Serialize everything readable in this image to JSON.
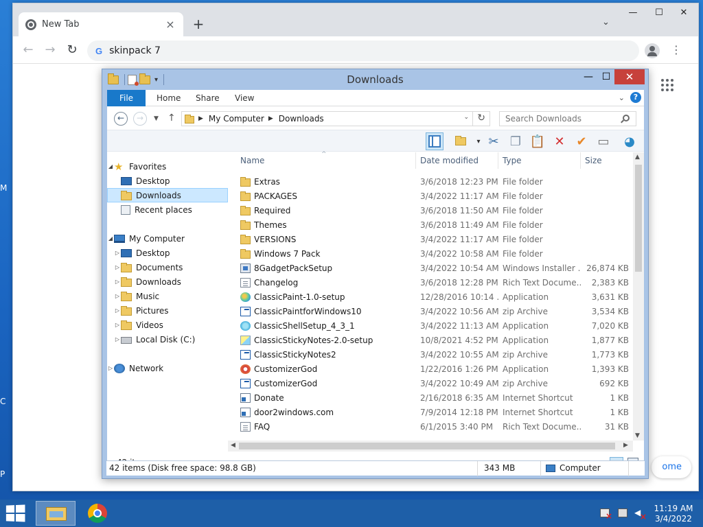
{
  "chrome": {
    "tab_title": "New Tab",
    "tab_close": "×",
    "new_tab": "+",
    "tab_search": "⌄",
    "omnibox_text": "skinpack 7",
    "g_letter": "G",
    "win_min": "—",
    "win_max": "☐",
    "win_close": "✕",
    "back": "←",
    "forward": "→",
    "reload": "↻",
    "menu": "⋮",
    "home_partial": "ome"
  },
  "explorer": {
    "title": "Downloads",
    "ribbon_tabs": [
      "File",
      "Home",
      "Share",
      "View"
    ],
    "help": "?",
    "ribbon_chevron": "⌄",
    "address": {
      "crumbs": [
        "My Computer",
        "Downloads"
      ]
    },
    "search_placeholder": "Search Downloads",
    "nav": {
      "favorites": "Favorites",
      "fav_items": [
        "Desktop",
        "Downloads",
        "Recent places"
      ],
      "computer": "My Computer",
      "computer_items": [
        "Desktop",
        "Documents",
        "Downloads",
        "Music",
        "Pictures",
        "Videos",
        "Local Disk (C:)"
      ],
      "network": "Network"
    },
    "columns": {
      "name": "Name",
      "date": "Date modified",
      "type": "Type",
      "size": "Size"
    },
    "files": [
      {
        "name": "Extras",
        "date": "3/6/2018 12:23 PM",
        "type": "File folder",
        "size": "",
        "icon": "folder-icon"
      },
      {
        "name": "PACKAGES",
        "date": "3/4/2022 11:17 AM",
        "type": "File folder",
        "size": "",
        "icon": "folder-icon"
      },
      {
        "name": "Required",
        "date": "3/6/2018 11:50 AM",
        "type": "File folder",
        "size": "",
        "icon": "folder-icon"
      },
      {
        "name": "Themes",
        "date": "3/6/2018 11:49 AM",
        "type": "File folder",
        "size": "",
        "icon": "folder-icon"
      },
      {
        "name": "VERSIONS",
        "date": "3/4/2022 11:17 AM",
        "type": "File folder",
        "size": "",
        "icon": "folder-icon"
      },
      {
        "name": "Windows 7 Pack",
        "date": "3/4/2022 10:58 AM",
        "type": "File folder",
        "size": "",
        "icon": "folder-icon"
      },
      {
        "name": "8GadgetPackSetup",
        "date": "3/4/2022 10:54 AM",
        "type": "Windows Installer ...",
        "size": "26,874 KB",
        "icon": "installer-icon"
      },
      {
        "name": "Changelog",
        "date": "3/6/2018 12:28 PM",
        "type": "Rich Text Docume...",
        "size": "2,383 KB",
        "icon": "rtf-document-icon"
      },
      {
        "name": "ClassicPaint-1.0-setup",
        "date": "12/28/2016 10:14 ...",
        "type": "Application",
        "size": "3,631 KB",
        "icon": "paint-app-icon"
      },
      {
        "name": "ClassicPaintforWindows10",
        "date": "3/4/2022 10:56 AM",
        "type": "zip Archive",
        "size": "3,534 KB",
        "icon": "zip-archive-icon"
      },
      {
        "name": "ClassicShellSetup_4_3_1",
        "date": "3/4/2022 11:13 AM",
        "type": "Application",
        "size": "7,020 KB",
        "icon": "shell-app-icon"
      },
      {
        "name": "ClassicStickyNotes-2.0-setup",
        "date": "10/8/2021 4:52 PM",
        "type": "Application",
        "size": "1,877 KB",
        "icon": "sticky-notes-icon"
      },
      {
        "name": "ClassicStickyNotes2",
        "date": "3/4/2022 10:55 AM",
        "type": "zip Archive",
        "size": "1,773 KB",
        "icon": "zip-archive-icon"
      },
      {
        "name": "CustomizerGod",
        "date": "1/22/2016 1:26 PM",
        "type": "Application",
        "size": "1,393 KB",
        "icon": "gear-app-icon"
      },
      {
        "name": "CustomizerGod",
        "date": "3/4/2022 10:49 AM",
        "type": "zip Archive",
        "size": "692 KB",
        "icon": "zip-archive-icon"
      },
      {
        "name": "Donate",
        "date": "2/16/2018 6:35 AM",
        "type": "Internet Shortcut",
        "size": "1 KB",
        "icon": "shortcut-icon"
      },
      {
        "name": "door2windows.com",
        "date": "7/9/2014 12:18 PM",
        "type": "Internet Shortcut",
        "size": "1 KB",
        "icon": "shortcut-icon"
      },
      {
        "name": "FAQ",
        "date": "6/1/2015 3:40 PM",
        "type": "Rich Text Docume...",
        "size": "31 KB",
        "icon": "rtf-document-icon"
      }
    ],
    "status_items": "42 items",
    "details": {
      "summary": "42 items (Disk free space: 98.8 GB)",
      "size": "343 MB",
      "location": "Computer"
    }
  },
  "taskbar": {
    "time": "11:19 AM",
    "date": "3/4/2022"
  }
}
